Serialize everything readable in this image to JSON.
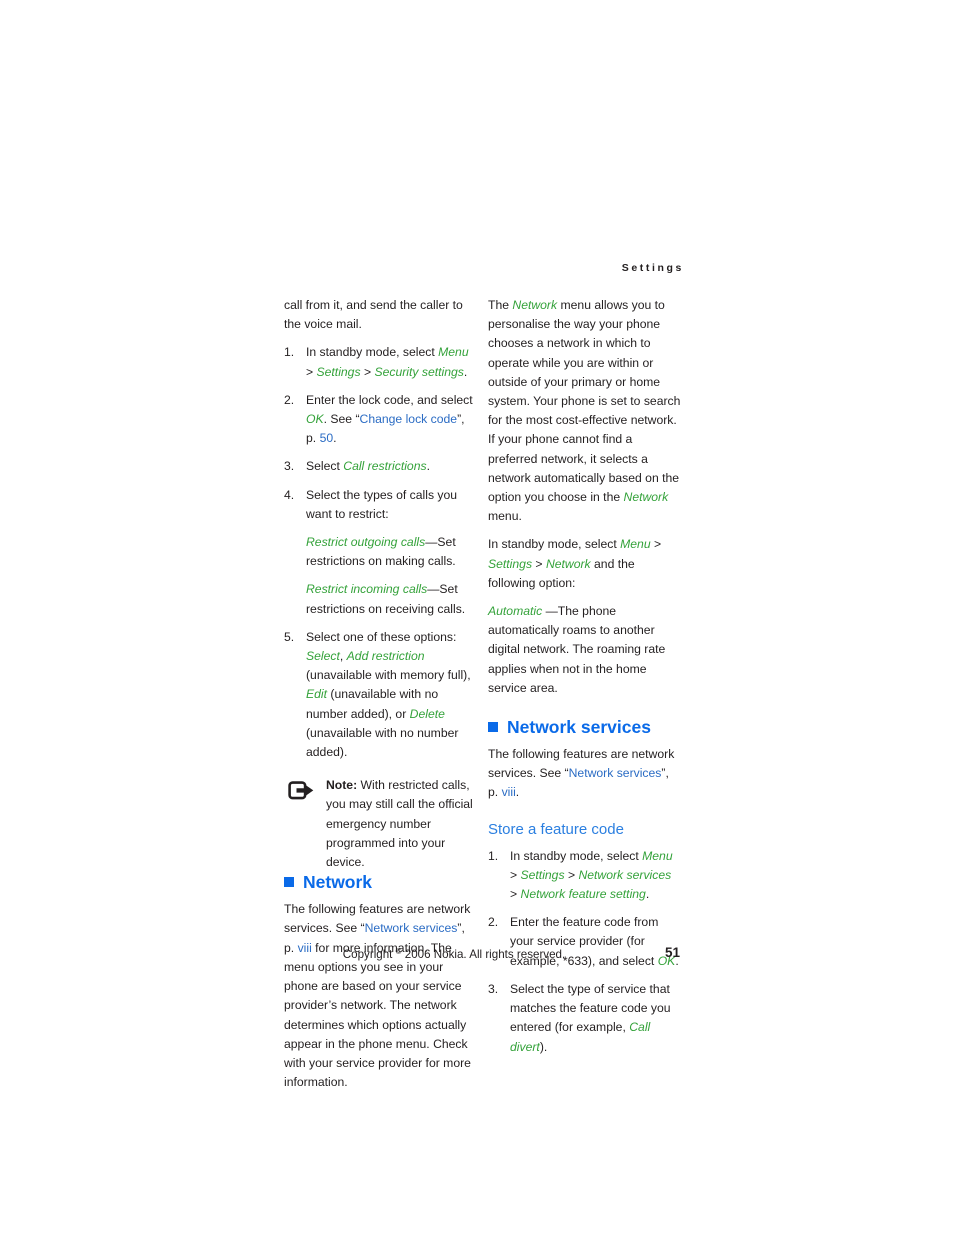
{
  "page": {
    "running_head": "Settings",
    "folio": "51",
    "copyright": "Copyright © 2006 Nokia. All rights reserved.",
    "copyright_pre": "Copyright ",
    "copyright_mark": "©",
    "copyright_post": " 2006 Nokia. All rights reserved."
  },
  "colors": {
    "heading_blue": "#0a6ae8",
    "subheading_blue": "#2b7fe0",
    "link_blue": "#2b6cc4",
    "ui_green": "#34a23a",
    "body_text": "#231f20"
  },
  "left_column": {
    "continued_paragraph": "call from it, and send the caller to the voice mail.",
    "steps": [
      {
        "num": "1.",
        "parts": [
          {
            "t": "In standby mode, select ",
            "s": "plain"
          },
          {
            "t": "Menu",
            "s": "ui"
          },
          {
            "t": " > ",
            "s": "plain"
          },
          {
            "t": "Settings",
            "s": "ui"
          },
          {
            "t": " > ",
            "s": "plain"
          },
          {
            "t": "Security settings",
            "s": "ui"
          },
          {
            "t": ".",
            "s": "plain"
          }
        ]
      },
      {
        "num": "2.",
        "parts": [
          {
            "t": "Enter the lock code, and select ",
            "s": "plain"
          },
          {
            "t": "OK",
            "s": "ui"
          },
          {
            "t": ". See “",
            "s": "plain"
          },
          {
            "t": "Change lock code",
            "s": "link"
          },
          {
            "t": "”, p. ",
            "s": "plain"
          },
          {
            "t": "50",
            "s": "link"
          },
          {
            "t": ".",
            "s": "plain"
          }
        ]
      },
      {
        "num": "3.",
        "parts": [
          {
            "t": "Select ",
            "s": "plain"
          },
          {
            "t": "Call restrictions",
            "s": "ui"
          },
          {
            "t": ".",
            "s": "plain"
          }
        ]
      },
      {
        "num": "4.",
        "parts": [
          {
            "t": "Select the types of calls you want to restrict:",
            "s": "plain"
          }
        ],
        "extra_paragraphs": [
          [
            {
              "t": "Restrict outgoing calls",
              "s": "ui"
            },
            {
              "t": "—Set restrictions on making calls.",
              "s": "plain"
            }
          ],
          [
            {
              "t": "Restrict incoming calls",
              "s": "ui"
            },
            {
              "t": "—Set restrictions on receiving calls.",
              "s": "plain"
            }
          ]
        ]
      },
      {
        "num": "5.",
        "parts": [
          {
            "t": "Select one of these options: ",
            "s": "plain"
          },
          {
            "t": "Select",
            "s": "ui"
          },
          {
            "t": ", ",
            "s": "plain"
          },
          {
            "t": "Add restriction",
            "s": "ui"
          },
          {
            "t": " (unavailable with memory full), ",
            "s": "plain"
          },
          {
            "t": "Edit",
            "s": "ui"
          },
          {
            "t": " (unavailable with no number added), or ",
            "s": "plain"
          },
          {
            "t": "Delete",
            "s": "ui"
          },
          {
            "t": " (unavailable with no number added).",
            "s": "plain"
          }
        ]
      }
    ],
    "note": {
      "icon": "note-arrow-icon",
      "label": "Note:",
      "text": " With restricted calls, you may still call the official emergency number programmed into your device."
    },
    "network_section": {
      "heading": "Network",
      "body_parts": [
        {
          "t": "The following features are network services. See “",
          "s": "plain"
        },
        {
          "t": "Network services",
          "s": "link"
        },
        {
          "t": "”, p. ",
          "s": "plain"
        },
        {
          "t": "viii",
          "s": "link"
        },
        {
          "t": " for more information. The menu options you see in your phone are based on your service provider’s network. The network determines which options actually appear in the phone menu. Check with your service provider for more information.",
          "s": "plain"
        }
      ]
    }
  },
  "right_column": {
    "network_intro_parts": [
      {
        "t": "The ",
        "s": "plain"
      },
      {
        "t": "Network",
        "s": "ui"
      },
      {
        "t": " menu allows you to personalise the way your phone chooses a network in which to operate while you are within or outside of your primary or home system. Your phone is set to search for the most cost-effective network. If your phone cannot find a preferred network, it selects a network automatically based on the option you choose in the ",
        "s": "plain"
      },
      {
        "t": "Network",
        "s": "ui"
      },
      {
        "t": " menu.",
        "s": "plain"
      }
    ],
    "standby_parts": [
      {
        "t": "In standby mode, select ",
        "s": "plain"
      },
      {
        "t": "Menu",
        "s": "ui"
      },
      {
        "t": " > ",
        "s": "plain"
      },
      {
        "t": "Settings",
        "s": "ui"
      },
      {
        "t": " > ",
        "s": "plain"
      },
      {
        "t": "Network",
        "s": "ui"
      },
      {
        "t": " and the following option:",
        "s": "plain"
      }
    ],
    "automatic_parts": [
      {
        "t": "Automatic",
        "s": "ui"
      },
      {
        "t": " —The phone automatically roams to another digital network. The roaming rate applies when not in the home service area.",
        "s": "plain"
      }
    ],
    "network_services_section": {
      "heading": "Network services",
      "body_parts": [
        {
          "t": "The following features are network services. See “",
          "s": "plain"
        },
        {
          "t": "Network services",
          "s": "link"
        },
        {
          "t": "”, p. ",
          "s": "plain"
        },
        {
          "t": "viii",
          "s": "link"
        },
        {
          "t": ".",
          "s": "plain"
        }
      ],
      "subheading": "Store a feature code",
      "steps": [
        {
          "num": "1.",
          "parts": [
            {
              "t": "In standby mode, select ",
              "s": "plain"
            },
            {
              "t": "Menu",
              "s": "ui"
            },
            {
              "t": " > ",
              "s": "plain"
            },
            {
              "t": "Settings",
              "s": "ui"
            },
            {
              "t": " > ",
              "s": "plain"
            },
            {
              "t": "Network services",
              "s": "ui"
            },
            {
              "t": " > ",
              "s": "plain"
            },
            {
              "t": "Network feature setting",
              "s": "ui"
            },
            {
              "t": ".",
              "s": "plain"
            }
          ]
        },
        {
          "num": "2.",
          "parts": [
            {
              "t": "Enter the feature code from your service provider (for example, *633), and select ",
              "s": "plain"
            },
            {
              "t": "OK",
              "s": "ui"
            },
            {
              "t": ".",
              "s": "plain"
            }
          ]
        },
        {
          "num": "3.",
          "parts": [
            {
              "t": "Select the type of service that matches the feature code you entered (for example, ",
              "s": "plain"
            },
            {
              "t": "Call divert",
              "s": "ui"
            },
            {
              "t": ").",
              "s": "plain"
            }
          ]
        }
      ]
    }
  }
}
